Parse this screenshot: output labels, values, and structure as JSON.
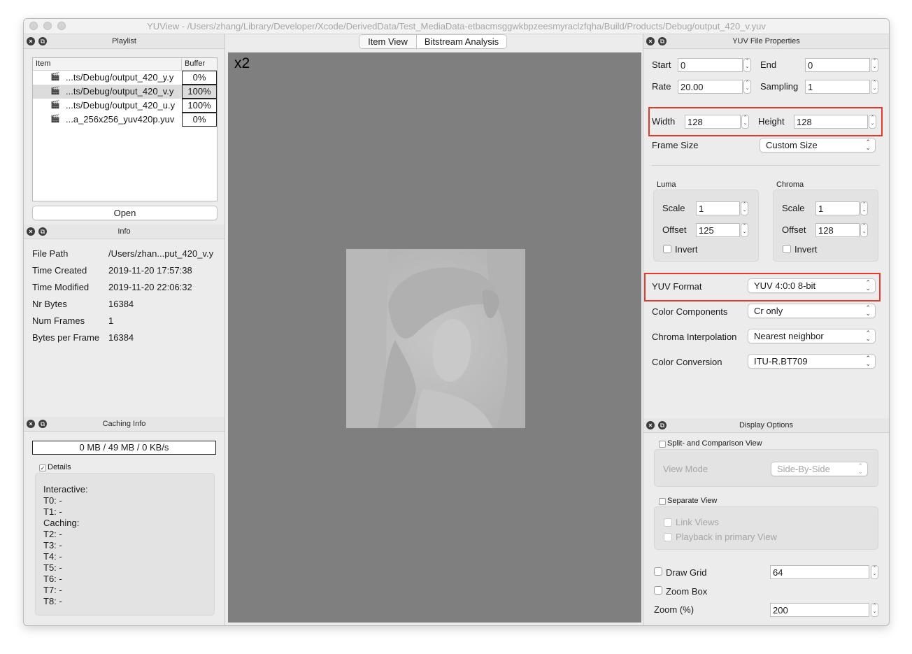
{
  "window": {
    "title": "YUView - /Users/zhang/Library/Developer/Xcode/DerivedData/Test_MediaData-etbacmsggwkbpzeesmyraclzfqha/Build/Products/Debug/output_420_v.yuv"
  },
  "playlist": {
    "title": "Playlist",
    "col_item": "Item",
    "col_buffer": "Buffer",
    "rows": [
      {
        "name": "...ts/Debug/output_420_y.y",
        "buffer": "0%"
      },
      {
        "name": "...ts/Debug/output_420_v.y",
        "buffer": "100%"
      },
      {
        "name": "...ts/Debug/output_420_u.y",
        "buffer": "100%"
      },
      {
        "name": "...a_256x256_yuv420p.yuv",
        "buffer": "0%"
      }
    ],
    "open_label": "Open"
  },
  "info": {
    "title": "Info",
    "rows": [
      {
        "label": "File Path",
        "value": "/Users/zhan...put_420_v.y"
      },
      {
        "label": "Time Created",
        "value": "2019-11-20 17:57:38"
      },
      {
        "label": "Time Modified",
        "value": "2019-11-20 22:06:32"
      },
      {
        "label": "Nr Bytes",
        "value": "16384"
      },
      {
        "label": "Num Frames",
        "value": "1"
      },
      {
        "label": "Bytes per Frame",
        "value": "16384"
      }
    ]
  },
  "caching": {
    "title": "Caching Info",
    "status": "0 MB / 49 MB / 0 KB/s",
    "details_label": "Details",
    "details_checked": true,
    "lines": [
      "Interactive:",
      "T0: -",
      "T1: -",
      "Caching:",
      "T2: -",
      "T3: -",
      "T4: -",
      "T5: -",
      "T6: -",
      "T7: -",
      "T8: -"
    ]
  },
  "center": {
    "tabs": [
      "Item View",
      "Bitstream Analysis"
    ],
    "active_tab": "Item View",
    "zoom_label": "x2",
    "canvas_bg": "#7f7f7f"
  },
  "yuv_props": {
    "title": "YUV File Properties",
    "start_label": "Start",
    "start_value": "0",
    "end_label": "End",
    "end_value": "0",
    "rate_label": "Rate",
    "rate_value": "20.00",
    "sampling_label": "Sampling",
    "sampling_value": "1",
    "width_label": "Width",
    "width_value": "128",
    "height_label": "Height",
    "height_value": "128",
    "frame_size_label": "Frame Size",
    "frame_size_value": "Custom Size",
    "luma": {
      "title": "Luma",
      "scale_label": "Scale",
      "scale_value": "1",
      "offset_label": "Offset",
      "offset_value": "125",
      "invert_label": "Invert"
    },
    "chroma": {
      "title": "Chroma",
      "scale_label": "Scale",
      "scale_value": "1",
      "offset_label": "Offset",
      "offset_value": "128",
      "invert_label": "Invert"
    },
    "yuv_format_label": "YUV Format",
    "yuv_format_value": "YUV 4:0:0 8-bit",
    "color_components_label": "Color Components",
    "color_components_value": "Cr only",
    "chroma_interp_label": "Chroma Interpolation",
    "chroma_interp_value": "Nearest neighbor",
    "color_conversion_label": "Color Conversion",
    "color_conversion_value": "ITU-R.BT709",
    "highlight_color": "#e8382a"
  },
  "display": {
    "title": "Display Options",
    "split_label": "Split- and Comparison View",
    "view_mode_label": "View Mode",
    "view_mode_value": "Side-By-Side",
    "separate_label": "Separate View",
    "link_views_label": "Link Views",
    "playback_label": "Playback in primary View",
    "draw_grid_label": "Draw Grid",
    "draw_grid_value": "64",
    "zoom_box_label": "Zoom Box",
    "zoom_label": "Zoom (%)",
    "zoom_value": "200"
  }
}
